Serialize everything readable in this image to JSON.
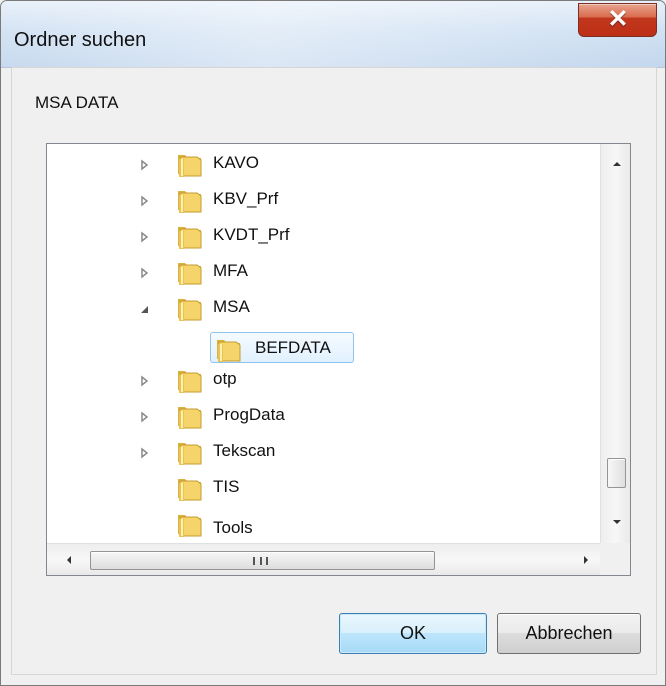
{
  "window": {
    "title": "Ordner suchen",
    "description": "MSA DATA",
    "close_icon": "x-icon"
  },
  "tree": {
    "items": [
      {
        "label": "KAVO",
        "expander": "collapsed",
        "selected": false
      },
      {
        "label": "KBV_Prf",
        "expander": "collapsed",
        "selected": false
      },
      {
        "label": "KVDT_Prf",
        "expander": "collapsed",
        "selected": false
      },
      {
        "label": "MFA",
        "expander": "collapsed",
        "selected": false
      },
      {
        "label": "MSA",
        "expander": "expanded",
        "selected": false
      },
      {
        "label": "BEFDATA",
        "expander": "none",
        "selected": true
      },
      {
        "label": "otp",
        "expander": "collapsed",
        "selected": false
      },
      {
        "label": "ProgData",
        "expander": "collapsed",
        "selected": false
      },
      {
        "label": "Tekscan",
        "expander": "collapsed",
        "selected": false
      },
      {
        "label": "TIS",
        "expander": "none",
        "selected": false
      },
      {
        "label": "Tools",
        "expander": "none",
        "selected": false
      }
    ],
    "scrollbar": {
      "horizontal_grip": "III"
    }
  },
  "buttons": {
    "ok": "OK",
    "cancel": "Abbrechen"
  },
  "colors": {
    "selection_border": "#8fc3ec",
    "selection_fill": "#e1f1ff",
    "folder_yellow": "#f4d46b",
    "close_red": "#c1371d",
    "default_button_blue": "#a7d9f5"
  }
}
